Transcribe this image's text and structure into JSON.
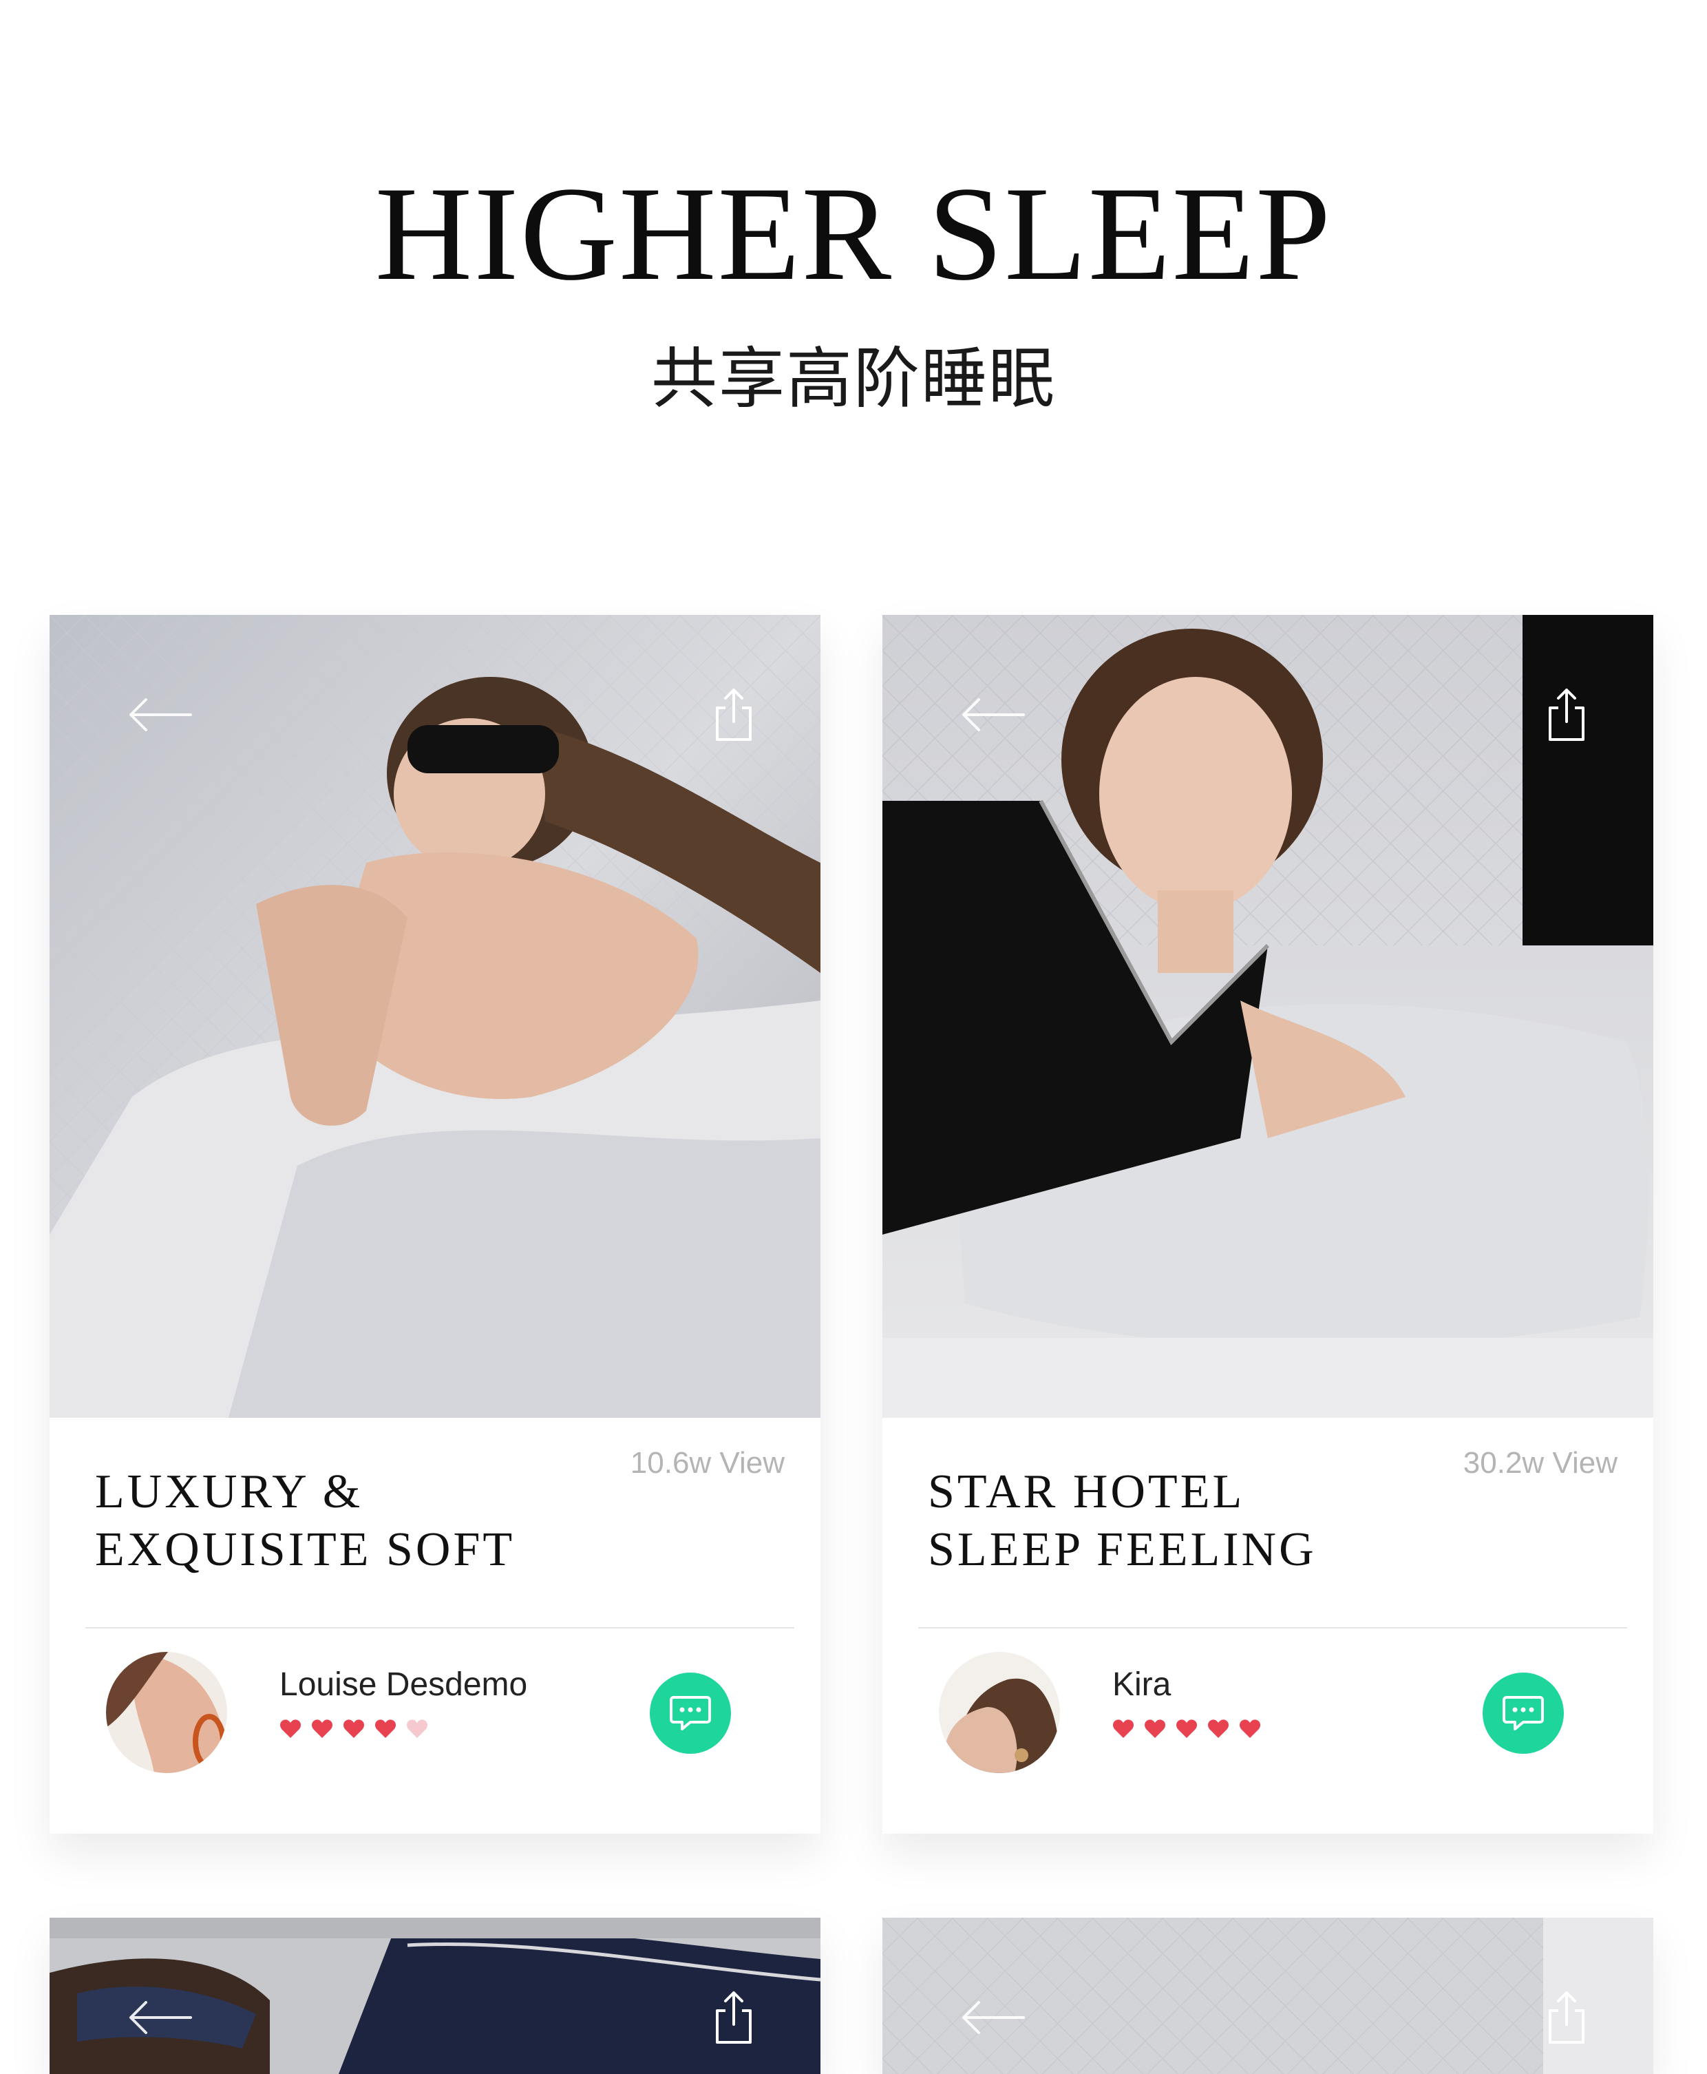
{
  "header": {
    "title": "HIGHER SLEEP",
    "subtitle": "共享高阶睡眠"
  },
  "cards": [
    {
      "title": "LUXURY &\nEXQUISITE SOFT",
      "views": "10.6w View",
      "author": "Louise Desdemo",
      "rating": 4,
      "rating_max": 5
    },
    {
      "title": "STAR HOTEL\nSLEEP FEELING",
      "views": "30.2w View",
      "author": "Kira",
      "rating": 5,
      "rating_max": 5
    }
  ],
  "icons": {
    "back": "arrow-left-icon",
    "share": "share-icon",
    "chat": "chat-bubble-icon",
    "heart": "heart-icon"
  },
  "colors": {
    "accent_green": "#1ed69b",
    "heart_filled": "#e8414f",
    "heart_empty": "#f6c9cf",
    "views_text": "#b4b4b4"
  }
}
